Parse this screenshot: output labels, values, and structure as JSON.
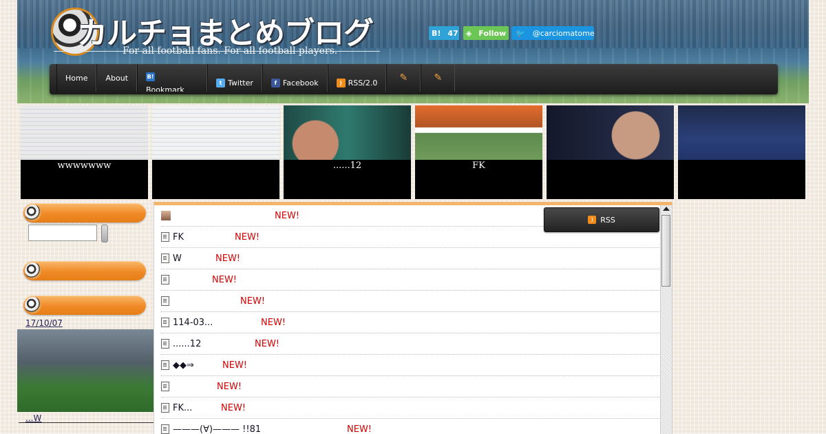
{
  "header": {
    "title": "カルチョまとめブログ",
    "tagline": "For all football fans.  For all football players.",
    "hatena_count": "47",
    "hatena_label": "B!",
    "follow_label": "Follow",
    "twitter_handle": "@carciomatome"
  },
  "nav": {
    "items": [
      {
        "label": "Home"
      },
      {
        "label": "About"
      },
      {
        "label": "Bookmark",
        "icon": "B!"
      },
      {
        "label": "Twitter"
      },
      {
        "label": "Facebook"
      },
      {
        "label": "RSS/2.0"
      },
      {
        "label": ""
      },
      {
        "label": ""
      }
    ]
  },
  "thumbs": [
    {
      "caption": "wwwwwww",
      "bg": "#d8d8d8"
    },
    {
      "caption": "",
      "bg": "#e6e6e6"
    },
    {
      "caption": "......12",
      "bg": "#2d6b60"
    },
    {
      "caption": "FK",
      "bg": "#7d8f6d"
    },
    {
      "caption": "",
      "bg": "#20253a"
    },
    {
      "caption": "",
      "bg": "#3c5a8a"
    }
  ],
  "sidebar": {
    "date": "17/10/07",
    "link": "...W"
  },
  "main": {
    "rss_label": "RSS",
    "new_label": "NEW!",
    "rows": [
      {
        "title": "",
        "icon": "face",
        "new_offset": "new1"
      },
      {
        "title": "FK",
        "icon": "doc",
        "new_offset": "new2"
      },
      {
        "title": "W",
        "icon": "doc",
        "new_offset": "new3"
      },
      {
        "title": "",
        "icon": "doc",
        "new_offset": "new4"
      },
      {
        "title": "",
        "icon": "doc",
        "new_offset": "new5"
      },
      {
        "title": "114-03...",
        "icon": "doc",
        "new_offset": "new6"
      },
      {
        "title": "......12",
        "icon": "doc",
        "new_offset": "new7"
      },
      {
        "title": "◆◆⇒",
        "icon": "doc",
        "new_offset": "new8"
      },
      {
        "title": "",
        "icon": "doc",
        "new_offset": "new9"
      },
      {
        "title": "FK...",
        "icon": "doc",
        "new_offset": "new10"
      },
      {
        "title": "———(∀)——— !!81",
        "icon": "doc",
        "new_offset": "new11"
      }
    ]
  },
  "colors": {
    "accent": "#f08a26",
    "new": "#d40000",
    "nav": "#1c1c1c"
  }
}
